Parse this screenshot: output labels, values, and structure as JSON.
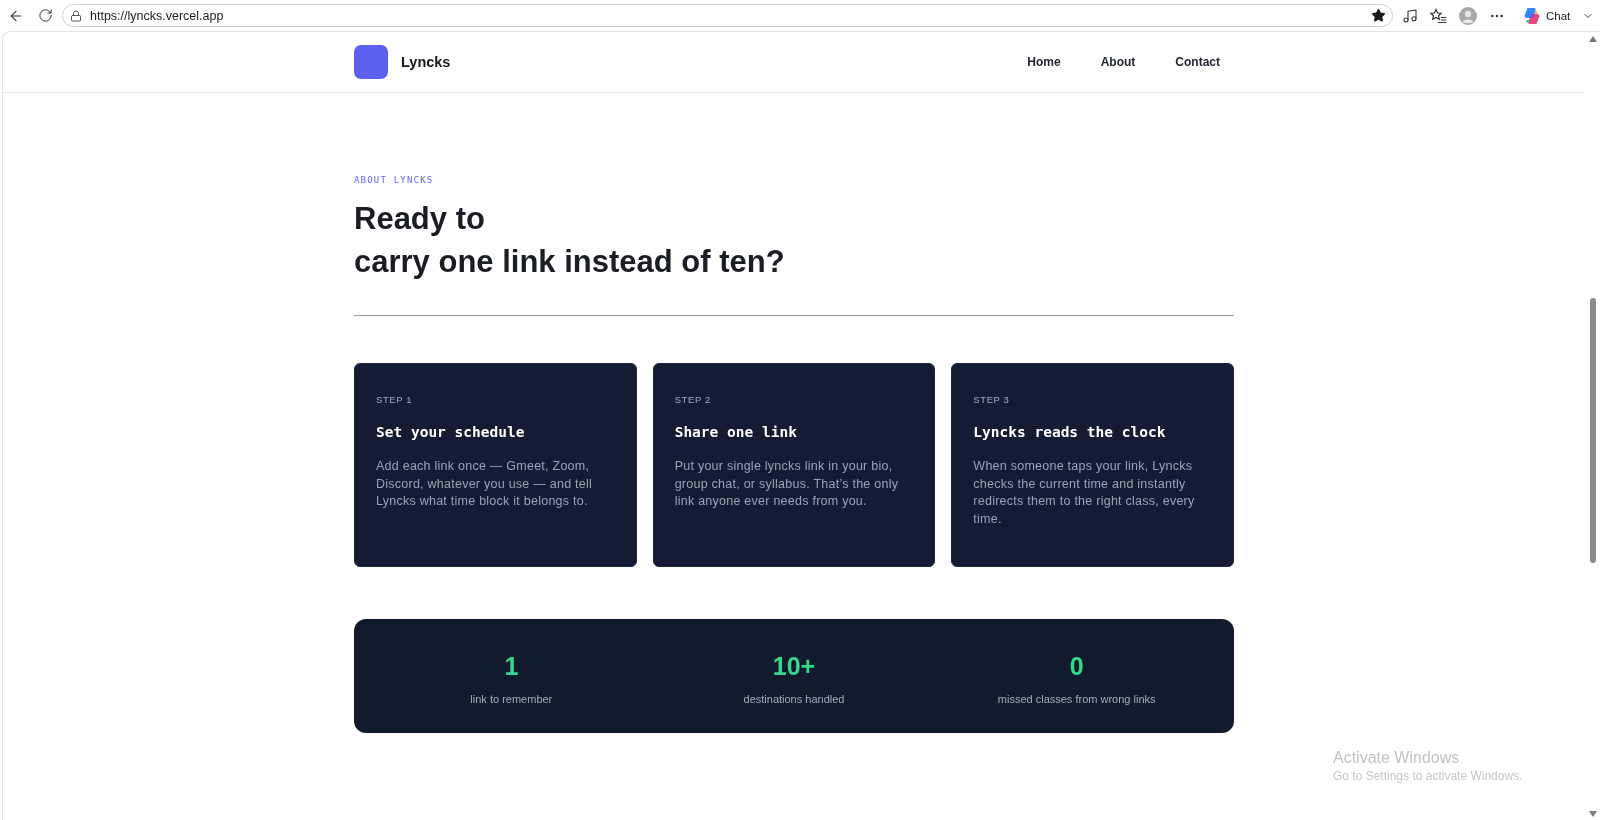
{
  "browser": {
    "url": "https://lyncks.vercel.app",
    "bookmarked": true,
    "chat_label": "Chat"
  },
  "nav": {
    "brand": "Lyncks",
    "links": [
      "Home",
      "About",
      "Contact"
    ]
  },
  "about": {
    "eyebrow": "ABOUT LYNCKS",
    "heading": [
      "Ready to",
      "carry one link instead of ten?"
    ]
  },
  "steps": [
    {
      "step": "STEP 1",
      "title": "Set your schedule",
      "body": "Add each link once — Gmeet, Zoom, Discord, whatever you use — and tell Lyncks what time block it belongs to."
    },
    {
      "step": "STEP 2",
      "title": "Share one link",
      "body": "Put your single lyncks link in your bio, group chat, or syllabus. That’s the only link anyone ever needs from you."
    },
    {
      "step": "STEP 3",
      "title": "Lyncks reads the clock",
      "body": "When someone taps your link, Lyncks checks the current time and instantly redirects them to the right class, every time."
    }
  ],
  "stats": [
    {
      "value": "1",
      "label": "link to remember"
    },
    {
      "value": "10+",
      "label": "destinations handled"
    },
    {
      "value": "0",
      "label": "missed classes from wrong links"
    }
  ],
  "os_notice": {
    "title": "Activate Windows",
    "subtitle": "Go to Settings to activate Windows."
  }
}
